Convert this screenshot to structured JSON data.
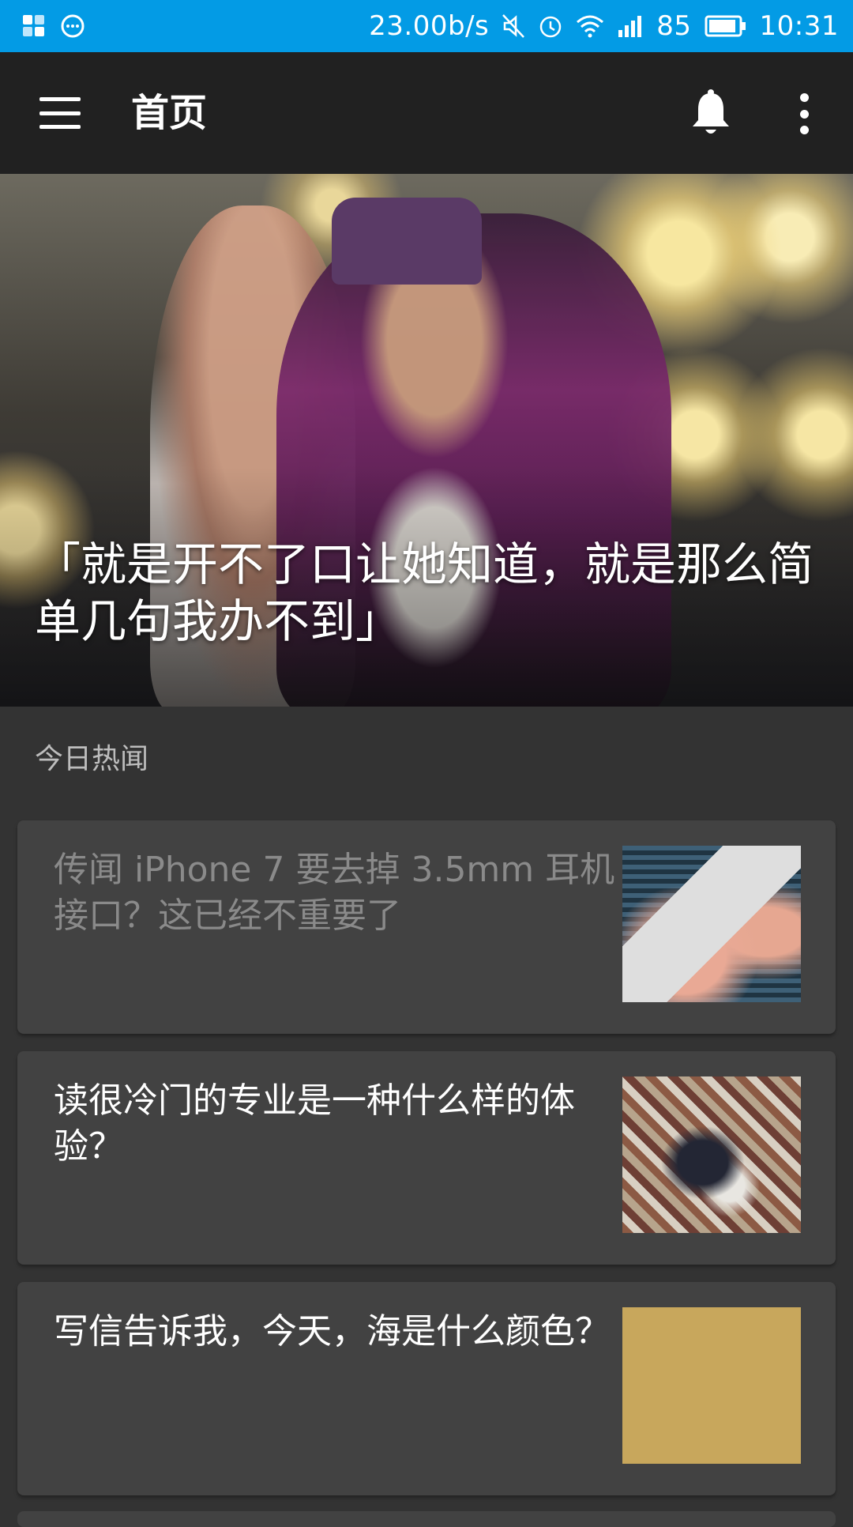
{
  "status_bar": {
    "network_speed": "23.00b/s",
    "battery_level": "85",
    "time": "10:31",
    "icons": [
      "windows-logo-icon",
      "chat-bubble-icon",
      "mute-icon",
      "alarm-icon",
      "wifi-icon",
      "signal-icon",
      "battery-icon"
    ],
    "bg_color": "#039be5"
  },
  "app_bar": {
    "title": "首页",
    "icons": [
      "menu-icon",
      "bell-icon",
      "more-vert-icon"
    ],
    "bg_color": "#212121"
  },
  "hero": {
    "caption": "「就是开不了口让她知道，就是那么简单几句我办不到」",
    "page_count": 5,
    "active_page": 5
  },
  "section": {
    "label": "今日热闻"
  },
  "stories": [
    {
      "title": "传闻 iPhone 7 要去掉  3.5mm 耳机接口？这已经不重要了",
      "read": true
    },
    {
      "title": "读很冷门的专业是一种什么样的体验？",
      "read": false
    },
    {
      "title": "写信告诉我，今天，海是什么颜色？",
      "read": false
    }
  ],
  "colors": {
    "background": "#333333",
    "card": "#424242",
    "read_text": "#8a8a8a",
    "section_text": "#bdbdbd"
  }
}
